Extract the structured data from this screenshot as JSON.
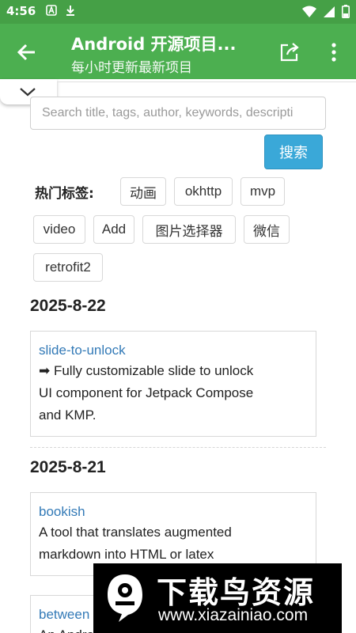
{
  "status_bar": {
    "time": "4:56"
  },
  "app_bar": {
    "title": "Android 开源项目...",
    "subtitle": "每小时更新最新项目"
  },
  "search": {
    "placeholder": "Search title, tags, author, keywords, descripti",
    "button_label": "搜索"
  },
  "tags": {
    "label": "热门标签:",
    "items": [
      "动画",
      "okhttp",
      "mvp",
      "video",
      "Add",
      "图片选择器",
      "微信",
      "retrofit2"
    ]
  },
  "sections": [
    {
      "date": "2025-8-22",
      "projects": [
        {
          "title": "slide-to-unlock",
          "desc_lines": [
            "➡ Fully customizable slide to unlock",
            "UI component for Jetpack Compose",
            "and KMP."
          ]
        }
      ]
    },
    {
      "date": "2025-8-21",
      "projects": [
        {
          "title": "bookish",
          "desc_lines": [
            "A tool that translates augmented",
            "markdown into HTML or latex"
          ]
        },
        {
          "title": "between",
          "desc_lines": [
            "An Android Experiment that marks"
          ]
        }
      ]
    }
  ],
  "watermark": {
    "title": "下载鸟资源",
    "url": "www.xiazainiao.com"
  },
  "colors": {
    "status_bar": "#45a046",
    "app_bar": "#4caf50",
    "link": "#337ab7",
    "search_button": "#3aa8d8"
  }
}
